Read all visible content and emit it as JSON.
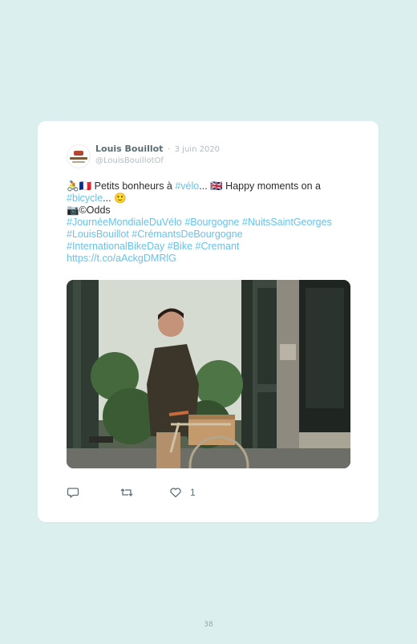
{
  "tweet": {
    "author_name": "Louis Bouillot",
    "separator": "·",
    "date": "3 juin 2020",
    "handle": "@LouisBouillotOf",
    "line1_prefix": "🚴🇫🇷 Petits bonheurs à ",
    "line1_tag": "#vélo",
    "line1_mid": "... 🇬🇧 Happy moments on a",
    "line2_tag": "#bicycle",
    "line2_suffix": "... 🙂",
    "line3": "📷©Odds",
    "hashtags_line1": "#JournéeMondialeDuVélo #Bourgogne #NuitsSaintGeorges",
    "hashtags_line2": "#LouisBouillot #CrémantsDeBourgogne",
    "hashtags_line3": "#InternationalBikeDay #Bike #Cremant",
    "url": "https://t.co/aAckgDMRlG",
    "likes": "1",
    "link_color": "#66c3f0"
  },
  "actions": {
    "reply_icon": "reply-icon",
    "retweet_icon": "retweet-icon",
    "like_icon": "heart-icon"
  },
  "page": {
    "number": "38"
  }
}
